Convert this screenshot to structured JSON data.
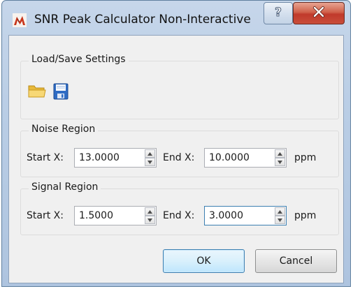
{
  "window": {
    "title": "SNR Peak Calculator Non-Interactive",
    "help_glyph": "?",
    "close_glyph": "X"
  },
  "icons": {
    "app": "matlab-logo-icon",
    "open": "folder-open-icon",
    "save": "floppy-disk-icon",
    "spin_up": "triangle-up-icon",
    "spin_down": "triangle-down-icon"
  },
  "load_save": {
    "title": "Load/Save Settings"
  },
  "noise": {
    "title": "Noise Region",
    "start_label": "Start X:",
    "start_value": "13.0000",
    "end_label": "End X:",
    "end_value": "10.0000",
    "unit": "ppm"
  },
  "signal": {
    "title": "Signal Region",
    "start_label": "Start X:",
    "start_value": "1.5000",
    "end_label": "End X:",
    "end_value": "3.0000",
    "unit": "ppm"
  },
  "buttons": {
    "ok": "OK",
    "cancel": "Cancel"
  },
  "colors": {
    "frame": "#b9cde5",
    "close": "#c0392b",
    "client": "#f0f0f0",
    "focus": "#3c7fb1"
  }
}
